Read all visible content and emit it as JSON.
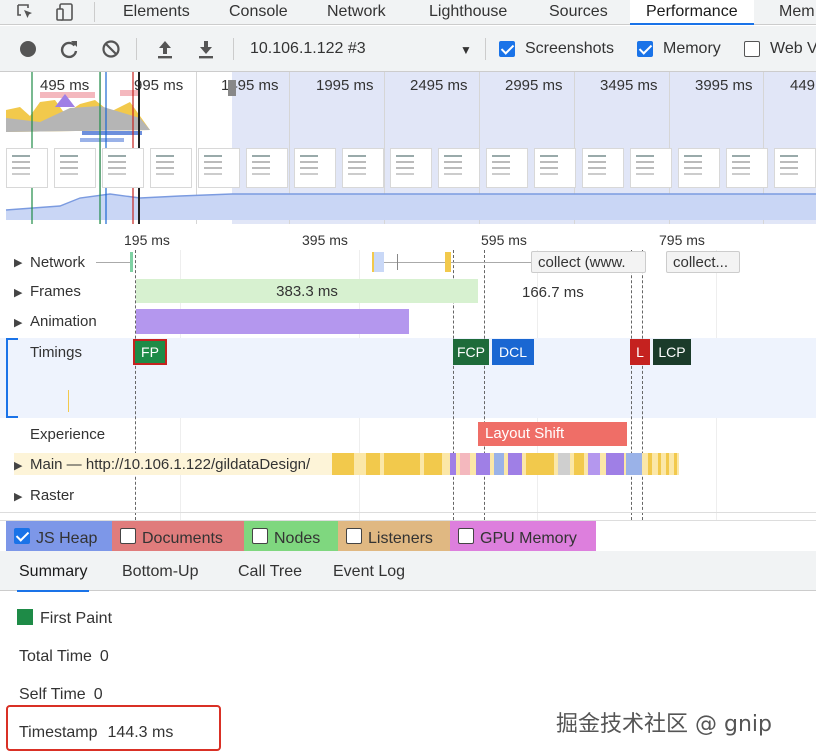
{
  "tabs": [
    "Elements",
    "Console",
    "Network",
    "Lighthouse",
    "Sources",
    "Performance",
    "Mem"
  ],
  "active_tab": "Performance",
  "toolbar": {
    "target": "10.106.1.122 #3",
    "screenshots_label": "Screenshots",
    "screenshots_checked": true,
    "memory_label": "Memory",
    "memory_checked": true,
    "webvitals_label": "Web V",
    "webvitals_checked": false
  },
  "overview": {
    "time_labels": [
      "495 ms",
      "995 ms",
      "1495 ms",
      "1995 ms",
      "2495 ms",
      "2995 ms",
      "3495 ms",
      "3995 ms",
      "449"
    ]
  },
  "ruler": [
    "195 ms",
    "395 ms",
    "595 ms",
    "795 ms"
  ],
  "tracks": {
    "network": "Network",
    "network_requests": [
      "collect (www.",
      "collect..."
    ],
    "frames": "Frames",
    "frame_durations": [
      "383.3 ms",
      "166.7 ms"
    ],
    "animation": "Animation",
    "timings": "Timings",
    "timing_markers": [
      "FP",
      "FCP",
      "DCL",
      "L",
      "LCP"
    ],
    "experience": "Experience",
    "layout_shift": "Layout Shift",
    "main": "Main — http://10.106.1.122/gildataDesign/",
    "raster": "Raster"
  },
  "memory": [
    {
      "label": "JS Heap",
      "checked": true,
      "color": "#7d97e8"
    },
    {
      "label": "Documents",
      "checked": false,
      "color": "#e07c7c"
    },
    {
      "label": "Nodes",
      "checked": false,
      "color": "#7fd77f"
    },
    {
      "label": "Listeners",
      "checked": false,
      "color": "#e0b882"
    },
    {
      "label": "GPU Memory",
      "checked": false,
      "color": "#dd7fdd"
    }
  ],
  "bottom_tabs": [
    "Summary",
    "Bottom-Up",
    "Call Tree",
    "Event Log"
  ],
  "summary": {
    "title": "First Paint",
    "total_time_label": "Total Time",
    "total_time": "0",
    "self_time_label": "Self Time",
    "self_time": "0",
    "timestamp_label": "Timestamp",
    "timestamp": "144.3 ms"
  },
  "watermark": "掘金技术社区 @ gnip",
  "colors": {
    "accent": "#1a73e8",
    "fp": "#1e8b47",
    "dcl": "#1a67d2",
    "load": "#c5221f",
    "lcp": "#1b3b2a",
    "layout_shift": "#ef6e67",
    "frames": "#d7f1d0",
    "animation": "#b497ee"
  }
}
